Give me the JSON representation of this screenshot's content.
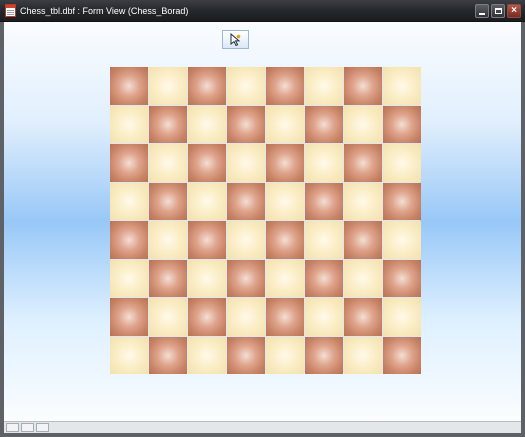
{
  "window": {
    "title": "Chess_tbl.dbf : Form View (Chess_Borad)",
    "icon": "form-document-icon",
    "buttons": [
      {
        "name": "minimize",
        "icon": "minimize-icon",
        "symbol": "▁"
      },
      {
        "name": "maximize",
        "icon": "maximize-icon",
        "symbol": "□"
      },
      {
        "name": "close",
        "icon": "close-icon",
        "symbol": "×"
      }
    ]
  },
  "toolbar": {
    "pointer_icon": "cursor-pointer-icon"
  },
  "board": {
    "rows": 8,
    "cols": 8,
    "pattern_first_square": "dark",
    "colors": {
      "dark": "#c88467",
      "light": "#fbeec7"
    }
  },
  "statusbar": {
    "cells": 3
  }
}
